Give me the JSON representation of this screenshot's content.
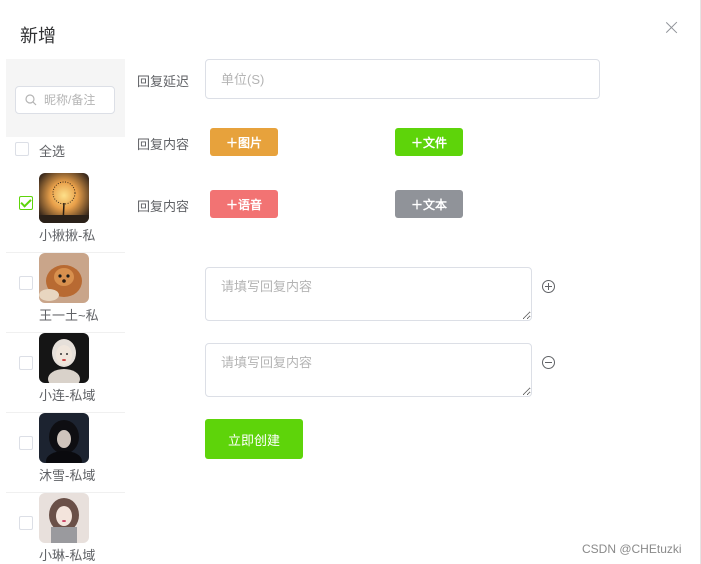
{
  "dialog": {
    "title": "新增"
  },
  "sidebar": {
    "search_placeholder": "昵称/备注",
    "select_all_label": "全选",
    "contacts": [
      {
        "name": "小揪揪-私",
        "checked": true,
        "avatar": "dandelion-sunset-avatar"
      },
      {
        "name": "王一土~私",
        "checked": false,
        "avatar": "dog-avatar"
      },
      {
        "name": "小连-私域",
        "checked": false,
        "avatar": "woman-portrait-avatar"
      },
      {
        "name": "沐雪-私域",
        "checked": false,
        "avatar": "woman-dark-avatar"
      },
      {
        "name": "小琳-私域",
        "checked": false,
        "avatar": "woman-scarf-avatar"
      }
    ]
  },
  "form": {
    "delay_label": "回复延迟",
    "delay_placeholder": "单位(S)",
    "content_label_1": "回复内容",
    "content_label_2": "回复内容",
    "buttons": {
      "image": "＋图片",
      "file": "＋文件",
      "voice": "＋语音",
      "text": "＋文本"
    },
    "reply_placeholder_1": "请填写回复内容",
    "reply_placeholder_2": "请填写回复内容",
    "create_label": "立即创建"
  },
  "colors": {
    "green": "#5ed40a",
    "orange": "#e7a23c",
    "red": "#f27373",
    "gray": "#909399"
  },
  "watermark": "CSDN @CHEtuzki"
}
